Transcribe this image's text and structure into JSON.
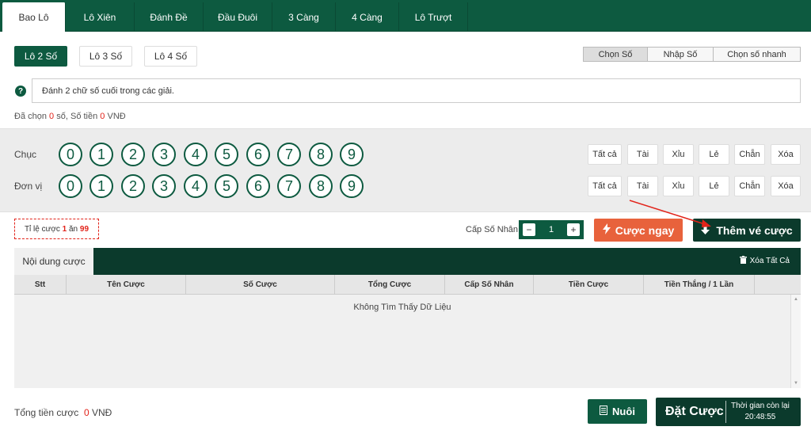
{
  "tabs": [
    "Bao Lô",
    "Lô Xiên",
    "Đánh Đề",
    "Đầu Đuôi",
    "3 Càng",
    "4 Càng",
    "Lô Trượt"
  ],
  "sub_types": [
    "Lô 2 Số",
    "Lô 3 Số",
    "Lô 4 Số"
  ],
  "modes": [
    "Chọn Số",
    "Nhập Số",
    "Chọn số nhanh"
  ],
  "description": "Đánh 2 chữ số cuối trong các giải.",
  "selected": {
    "prefix": "Đã chọn",
    "count": "0",
    "count_unit": "số,",
    "money_label": "Số tiền",
    "money": "0",
    "currency": "VNĐ"
  },
  "rows": [
    {
      "label": "Chục"
    },
    {
      "label": "Đơn vị"
    }
  ],
  "numbers": [
    "0",
    "1",
    "2",
    "3",
    "4",
    "5",
    "6",
    "7",
    "8",
    "9"
  ],
  "quick_buttons": [
    "Tất cả",
    "Tài",
    "Xỉu",
    "Lẻ",
    "Chẵn",
    "Xóa"
  ],
  "rate": {
    "label": "Tỉ lệ cược",
    "a": "1",
    "mid": "ăn",
    "b": "99"
  },
  "multiplier": {
    "label": "Cấp Số Nhân",
    "value": "1",
    "minus": "−",
    "plus": "+"
  },
  "buttons": {
    "bet_now": "Cược ngay",
    "add_ticket": "Thêm vé cược",
    "nuoi": "Nuôi",
    "place": "Đặt Cược"
  },
  "content": {
    "tab": "Nội dung cược",
    "clear_all": "Xóa Tất Cả",
    "columns": [
      "Stt",
      "Tên Cược",
      "Số Cược",
      "Tổng Cược",
      "Cấp Số Nhân",
      "Tiền Cược",
      "Tiền Thắng / 1 Lần"
    ],
    "empty": "Không Tìm Thấy Dữ Liệu"
  },
  "total": {
    "label": "Tổng tiền cược",
    "value": "0",
    "currency": "VNĐ"
  },
  "timer": {
    "label": "Thời gian còn lại",
    "value": "20:48:55"
  },
  "colors": {
    "primary": "#0d5a40",
    "dark": "#0b3a2c",
    "accent": "#e8623c",
    "red": "#e2231a"
  }
}
